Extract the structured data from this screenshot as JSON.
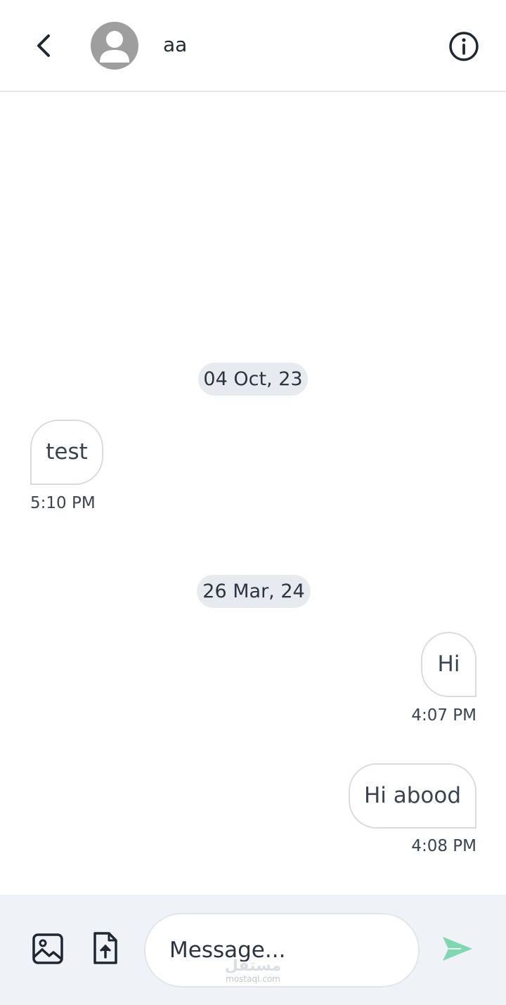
{
  "header": {
    "contact_name": "aa"
  },
  "chat": {
    "groups": [
      {
        "date": "04 Oct, 23",
        "messages": [
          {
            "direction": "incoming",
            "text": "test",
            "time": "5:10 PM"
          }
        ]
      },
      {
        "date": "26 Mar, 24",
        "messages": [
          {
            "direction": "outgoing",
            "text": "Hi",
            "time": "4:07 PM"
          },
          {
            "direction": "outgoing",
            "text": "Hi abood",
            "time": "4:08 PM"
          }
        ]
      }
    ]
  },
  "composer": {
    "placeholder": "Message..."
  },
  "watermark": {
    "logo_text": "مستقل",
    "text": "mostaql.com"
  },
  "colors": {
    "send_accent": "#7fd8b0",
    "avatar_gray": "#9e9e9e",
    "date_chip_bg": "#e7eaee",
    "composer_bg": "#eff3f8"
  },
  "icons": {
    "back": "chevron-left-icon",
    "avatar": "user-silhouette-icon",
    "info": "info-circle-icon",
    "gallery": "image-icon",
    "attach": "file-upload-icon",
    "send": "send-arrow-icon"
  }
}
